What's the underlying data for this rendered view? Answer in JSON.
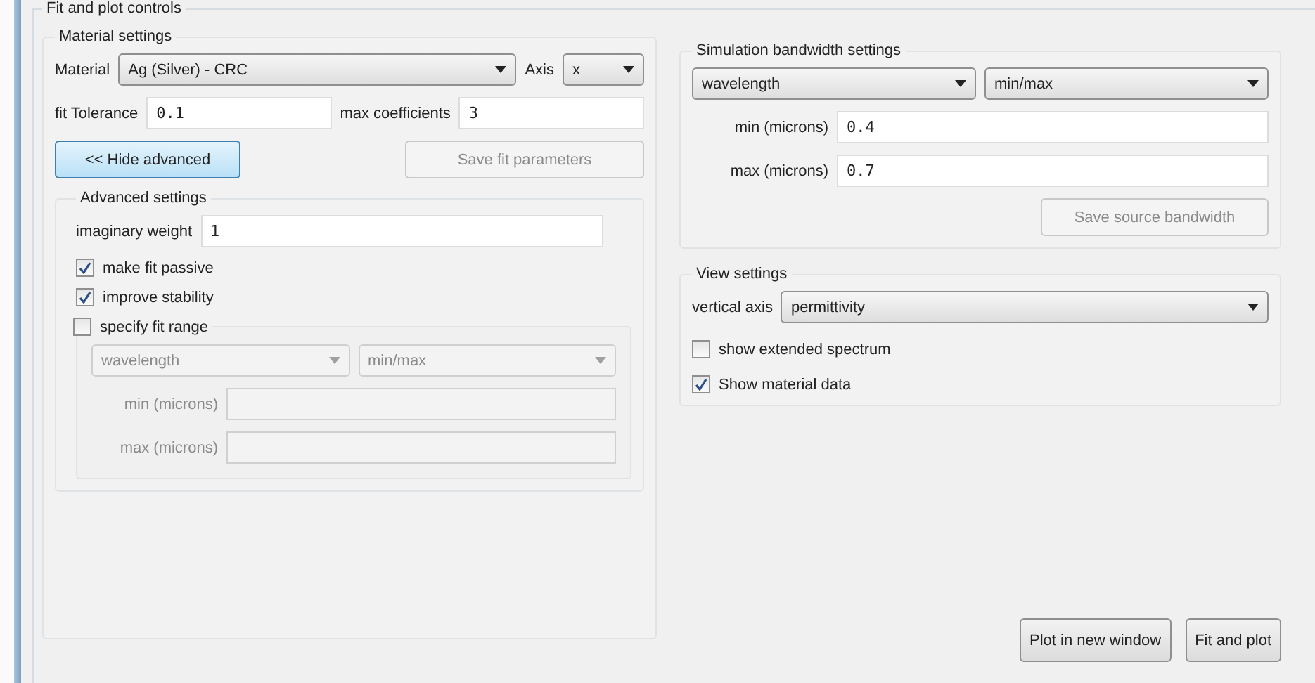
{
  "title": "Fit and plot controls",
  "material_settings": {
    "title": "Material settings",
    "material": {
      "label": "Material",
      "value": "Ag (Silver) - CRC"
    },
    "axis": {
      "label": "Axis",
      "value": "x"
    },
    "fit_tolerance": {
      "label": "fit Tolerance",
      "value": "0.1"
    },
    "max_coefficients": {
      "label": "max coefficients",
      "value": "3"
    },
    "buttons": [
      {
        "label": "<< Hide advanced",
        "disabled": false,
        "focused": true
      },
      {
        "label": "Save fit parameters",
        "disabled": true,
        "focused": false
      }
    ],
    "advanced": {
      "title": "Advanced settings",
      "imaginary_weight": {
        "label": "imaginary weight",
        "value": "1"
      },
      "checkboxes": [
        {
          "label": "make fit passive",
          "checked": true
        },
        {
          "label": "improve stability",
          "checked": true
        }
      ],
      "fit_range": {
        "label": "specify fit range",
        "checked": false,
        "disabled": true,
        "quantity": "wavelength",
        "mode": "min/max",
        "min_label": "min (microns)",
        "max_label": "max (microns)"
      }
    }
  },
  "bandwidth": {
    "title": "Simulation bandwidth settings",
    "quantity": "wavelength",
    "mode": "min/max",
    "min": {
      "label": "min (microns)",
      "value": "0.4"
    },
    "max": {
      "label": "max (microns)",
      "value": "0.7"
    },
    "button": {
      "label": "Save source bandwidth",
      "disabled": true
    }
  },
  "view": {
    "title": "View settings",
    "vertical_axis": {
      "label": "vertical axis",
      "value": "permittivity"
    },
    "checkboxes": [
      {
        "label": "show extended spectrum",
        "checked": false
      },
      {
        "label": "Show material data",
        "checked": true
      }
    ]
  },
  "buttons": [
    {
      "label": "Plot in new window",
      "disabled": false
    },
    {
      "label": "Fit and plot",
      "disabled": false
    }
  ]
}
